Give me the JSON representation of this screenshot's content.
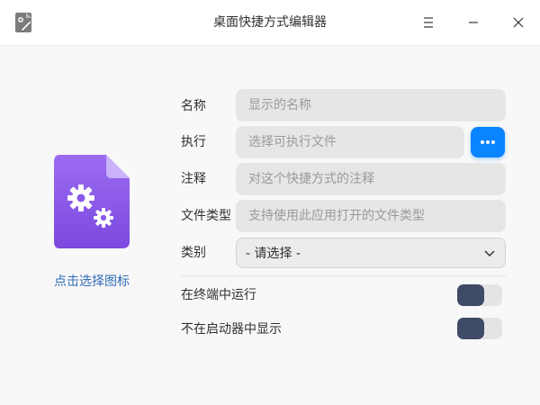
{
  "window": {
    "title": "桌面快捷方式编辑器",
    "app_icon": "desktop-file-editor-icon"
  },
  "icon_panel": {
    "icon": "gears-document-icon",
    "icon_color": "#8a5bea",
    "choose_icon_label": "点击选择图标"
  },
  "form": {
    "name": {
      "label": "名称",
      "placeholder": "显示的名称",
      "value": ""
    },
    "exec": {
      "label": "执行",
      "placeholder": "选择可执行文件",
      "value": "",
      "browse_icon": "more-horizontal-icon"
    },
    "comment": {
      "label": "注释",
      "placeholder": "对这个快捷方式的注释",
      "value": ""
    },
    "mime_type": {
      "label": "文件类型",
      "placeholder": "支持使用此应用打开的文件类型",
      "value": ""
    },
    "category": {
      "label": "类别",
      "selected": "- 请选择 -"
    },
    "run_in_terminal": {
      "label": "在终端中运行",
      "enabled": false
    },
    "hide_in_launcher": {
      "label": "不在启动器中显示",
      "enabled": false
    }
  },
  "colors": {
    "accent": "#0a84ff",
    "link": "#2f6bb5",
    "toggle_knob": "#3e4a66"
  }
}
